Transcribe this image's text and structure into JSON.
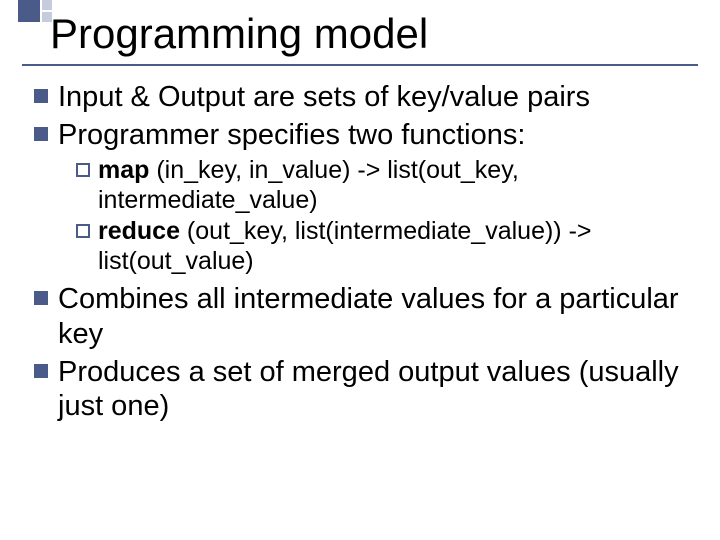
{
  "slide": {
    "title": "Programming model",
    "b1": "Input & Output are sets of key/value pairs",
    "b2": "Programmer specifies two functions:",
    "sub1_bold": "map",
    "sub1_rest": " (in_key, in_value) -> list(out_key, intermediate_value)",
    "sub2_bold": "reduce",
    "sub2_rest": " (out_key, list(intermediate_value)) -> list(out_value)",
    "b3": "Combines all intermediate values for a particular key",
    "b4": "Produces a set of merged output values (usually just one)"
  }
}
